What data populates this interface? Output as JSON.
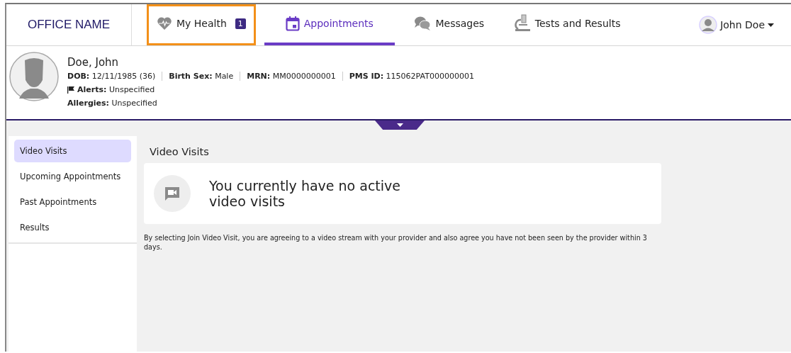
{
  "header": {
    "office_name": "OFFICE NAME",
    "tabs": [
      {
        "label": "My Health",
        "kind": "heart",
        "badge": "1",
        "selected": false,
        "highlighted": true
      },
      {
        "label": "Appointments",
        "kind": "calendar",
        "selected": true,
        "highlighted": false
      },
      {
        "label": "Messages",
        "kind": "chat",
        "selected": false,
        "highlighted": false
      },
      {
        "label": "Tests and Results",
        "kind": "microscope",
        "selected": false,
        "highlighted": false
      }
    ],
    "user_menu": {
      "label": "John Doe"
    }
  },
  "patient": {
    "name": "Doe, John",
    "fields": [
      {
        "label": "DOB:",
        "value": "12/11/1985 (36)"
      },
      {
        "label": "Birth Sex:",
        "value": "Male"
      },
      {
        "label": "MRN:",
        "value": "MM0000000001"
      },
      {
        "label": "PMS ID:",
        "value": "115062PAT000000001"
      }
    ],
    "alerts": {
      "label": "Alerts:",
      "value": "Unspecified"
    },
    "allergies": {
      "label": "Allergies:",
      "value": "Unspecified"
    }
  },
  "sidebar": {
    "items": [
      {
        "label": "Video Visits",
        "selected": true
      },
      {
        "label": "Upcoming Appointments",
        "selected": false
      },
      {
        "label": "Past Appointments",
        "selected": false
      },
      {
        "label": "Results",
        "selected": false
      }
    ]
  },
  "content": {
    "title": "Video Visits",
    "empty_message": "You currently have no active video visits",
    "disclaimer": "By selecting Join Video Visit, you are agreeing to a video stream with your provider and also agree you have not been seen by the provider within 3 days."
  }
}
